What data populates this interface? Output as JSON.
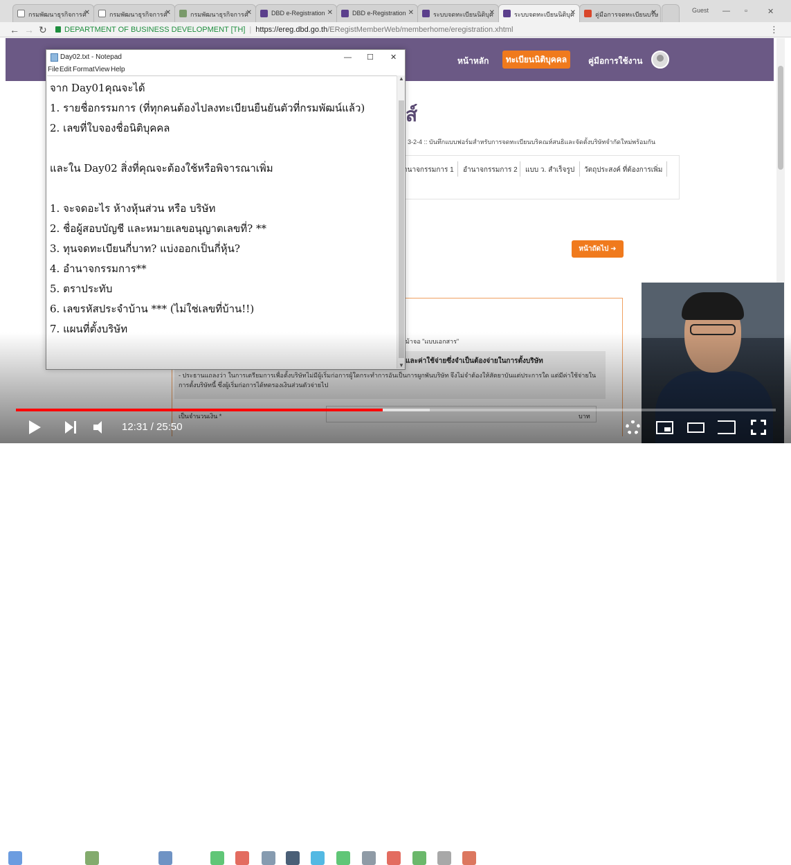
{
  "browser": {
    "tabs": [
      {
        "label": "กรมพัฒนาธุรกิจการค้",
        "icon": "page-icon"
      },
      {
        "label": "กรมพัฒนาธุรกิจการค้",
        "icon": "page-icon"
      },
      {
        "label": "กรมพัฒนาธุรกิจการค้",
        "icon": "image-icon"
      },
      {
        "label": "DBD e-Registration",
        "icon": "dbd-icon"
      },
      {
        "label": "DBD e-Registration",
        "icon": "dbd-icon"
      },
      {
        "label": "ระบบจดทะเบียนนิติบุค",
        "icon": "dbd-icon"
      },
      {
        "label": "ระบบจดทะเบียนนิติบุค",
        "icon": "dbd-icon"
      },
      {
        "label": "คู่มือการจดทะเบียนบริษ",
        "icon": "pdf-icon"
      }
    ],
    "profile": "Guest",
    "site_identity": "DEPARTMENT OF BUSINESS DEVELOPMENT [TH]",
    "url_host": "https://ereg.dbd.go.th",
    "url_path": "/ERegistMemberWeb/memberhome/eregistration.xhtml"
  },
  "site": {
    "nav": {
      "home": "หน้าหลัก",
      "register": "ทะเบียนนิติบุคคล",
      "manual": "คู่มือการใช้งาน"
    },
    "page_title_fragment": "ส์",
    "breadcrumb": "3-2-4 :: บันทึกแบบฟอร์มสำหรับการจดทะเบียนบริคณห์สนธิและจัดตั้งบริษัทจำกัดใหม่พร้อมกัน",
    "tabs": [
      "ำนาจกรรมการ 1",
      "อำนาจกรรมการ 2",
      "แบบ ว. สำเร็จรูป",
      "วัตถุประสงค์ ที่ต้องการเพิ่ม"
    ],
    "next_button": "หน้าถัดไป ➜",
    "form_note_top": "ม้าจอ \"แบบเอกสาร\"",
    "note_heading": "และค่าใช้จ่ายซึ่งจำเป็นต้องจ่ายในการตั้งบริษัท",
    "note_body": "- ประธานแถลงว่า ในการเตรียมการเพื่อตั้งบริษัทไม่มีผู้เริ่มก่อการผู้ใดกระทำการอันเป็นการผูกพันบริษัท จึงไม่จำต้องให้สัตยาบันแต่ประการใด แต่มีค่าใช้จ่ายในการตั้งบริษัทนี้ ซึ่งผู้เริ่มก่อการได้ทดรองเงินส่วนตัวจ่ายไป",
    "amount_label": "เป็นจำนวนเงิน *",
    "amount_unit": "บาท"
  },
  "notepad": {
    "title": "Day02.txt - Notepad",
    "menu": [
      "File",
      "Edit",
      "Format",
      "View",
      "Help"
    ],
    "lines": [
      "จาก Day01คุณจะได้",
      "1. รายชื่อกรรมการ (ที่ทุกคนต้องไปลงทะเบียนยืนยันตัวที่กรมพัฒน์แล้ว)",
      "2. เลขที่ใบจองชื่อนิติบุคคล",
      "",
      "และใน Day02 สิ่งที่คุณจะต้องใช้หรือพิจารณาเพิ่ม",
      "",
      "1. จะจดอะไร ห้างหุ้นส่วน หรือ บริษัท",
      "2. ชื่อผู้สอบบัญชี และหมายเลขอนุญาตเลขที่? **",
      "3. ทุนจดทะเบียนกี่บาท? แบ่งออกเป็นกี่หุ้น?",
      "4. อำนาจกรรมการ**",
      "5. ตราประทับ",
      "6. เลขรหัสประจำบ้าน *** (ไม่ใช่เลขที่บ้าน!!)",
      "7. แผนที่ตั้งบริษัท"
    ]
  },
  "video": {
    "time": "12:31 / 25:50",
    "progress_played": 0.483,
    "progress_buffered": 0.545
  },
  "colors": {
    "header_purple": "#6b5985",
    "accent_orange": "#f07a1d",
    "progress_red": "#ff0000"
  }
}
